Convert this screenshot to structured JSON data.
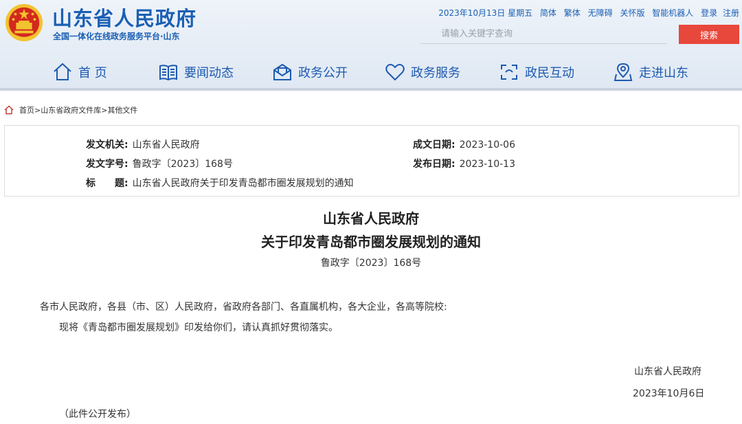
{
  "header": {
    "title": "山东省人民政府",
    "subtitle": "全国一体化在线政务服务平台·山东",
    "date": "2023年10月13日 星期五",
    "links": [
      "简体",
      "繁体",
      "无障碍",
      "关怀版",
      "智能机器人",
      "登录",
      "注册"
    ],
    "search": {
      "placeholder": "请输入关键字查询",
      "button": "搜索"
    }
  },
  "nav": {
    "items": [
      {
        "label": "首 页",
        "icon": "home-icon"
      },
      {
        "label": "要闻动态",
        "icon": "news-icon"
      },
      {
        "label": "政务公开",
        "icon": "mail-icon"
      },
      {
        "label": "政务服务",
        "icon": "heart-icon"
      },
      {
        "label": "政民互动",
        "icon": "interaction-icon"
      },
      {
        "label": "走进山东",
        "icon": "location-icon"
      }
    ]
  },
  "breadcrumb": {
    "items": [
      "首页",
      "山东省政府文件库",
      "其他文件"
    ],
    "separator": ">"
  },
  "meta": {
    "issuer_label": "发文机关:",
    "issuer": "山东省人民政府",
    "doc_no_label": "发文字号:",
    "doc_no": "鲁政字〔2023〕168号",
    "title_label": "标　　题:",
    "title": "山东省人民政府关于印发青岛都市圈发展规划的通知",
    "created_label": "成文日期:",
    "created": "2023-10-06",
    "published_label": "发布日期:",
    "published": "2023-10-13"
  },
  "document": {
    "title_line1": "山东省人民政府",
    "title_line2": "关于印发青岛都市圈发展规划的通知",
    "number": "鲁政字〔2023〕168号",
    "salutation": "各市人民政府，各县（市、区）人民政府，省政府各部门、各直属机构，各大企业，各高等院校:",
    "body": "现将《青岛都市圈发展规划》印发给你们，请认真抓好贯彻落实。",
    "signature": "山东省人民政府",
    "sign_date": "2023年10月6日",
    "note": "（此件公开发布）"
  },
  "colors": {
    "brand": "#1a5fb4",
    "search_button": "#e8473c",
    "emblem_red": "#d4281e",
    "emblem_gold": "#f2c230"
  }
}
